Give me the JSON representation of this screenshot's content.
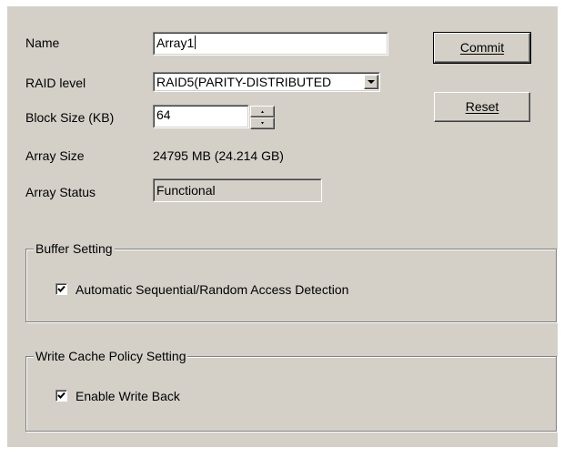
{
  "form": {
    "name_label": "Name",
    "name_value": "Array1",
    "raid_label": "RAID level",
    "raid_value": "RAID5(PARITY-DISTRIBUTED",
    "block_label": "Block Size (KB)",
    "block_value": "64",
    "array_size_label": "Array Size",
    "array_size_value": "24795 MB (24.214 GB)",
    "array_status_label": "Array Status",
    "array_status_value": "Functional"
  },
  "buttons": {
    "commit_label": "Commit",
    "reset_label": "Reset"
  },
  "buffer_group": {
    "title": "Buffer Setting",
    "option_label": "Automatic Sequential/Random Access Detection",
    "option_checked": true
  },
  "cache_group": {
    "title": "Write Cache Policy Setting",
    "option_label": "Enable Write Back",
    "option_checked": true
  }
}
